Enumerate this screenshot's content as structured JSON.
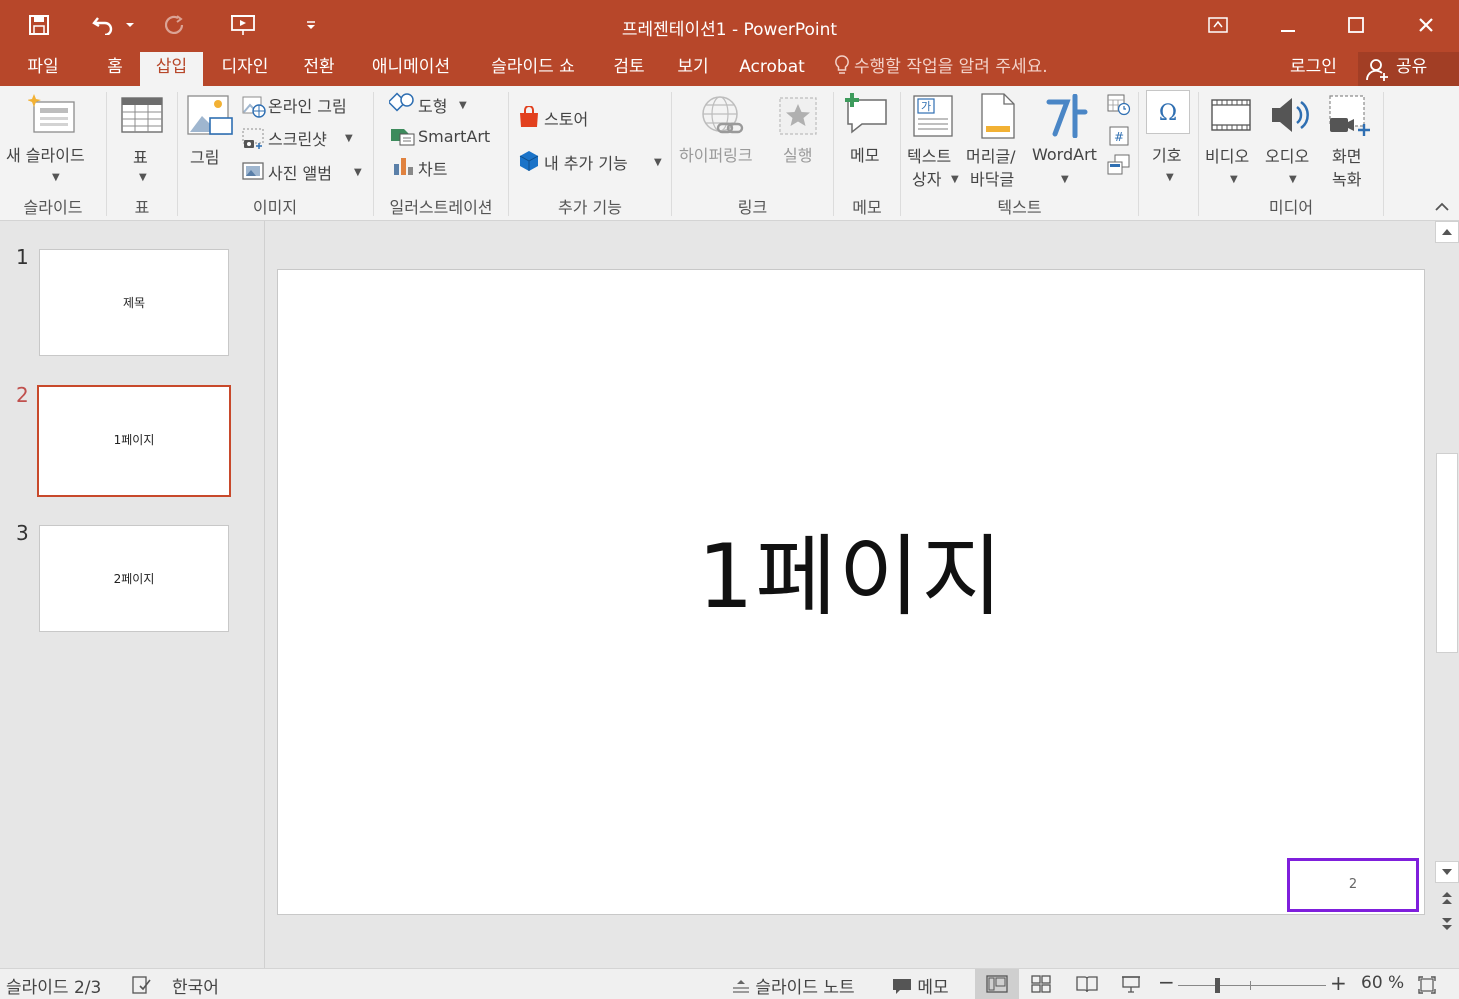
{
  "window": {
    "title": "프레젠테이션1 - PowerPoint"
  },
  "menu_tabs": [
    {
      "label": "파일"
    },
    {
      "label": "홈"
    },
    {
      "label": "삽입",
      "active": true
    },
    {
      "label": "디자인"
    },
    {
      "label": "전환"
    },
    {
      "label": "애니메이션"
    },
    {
      "label": "슬라이드 쇼"
    },
    {
      "label": "검토"
    },
    {
      "label": "보기"
    },
    {
      "label": "Acrobat"
    }
  ],
  "tell_me": "수행할 작업을 알려 주세요.",
  "login": "로그인",
  "share": "공유",
  "ribbon": {
    "new_slide": "새 슬라이드",
    "table": "표",
    "picture": "그림",
    "online_picture": "온라인 그림",
    "screenshot": "스크린샷",
    "photo_album": "사진 앨범",
    "shapes": "도형",
    "smartart": "SmartArt",
    "chart": "차트",
    "store": "스토어",
    "my_addins": "내 추가 기능",
    "hyperlink": "하이퍼링크",
    "action": "실행",
    "comment": "메모",
    "textbox_1": "텍스트",
    "textbox_2": "상자",
    "header_1": "머리글/",
    "header_2": "바닥글",
    "wordart": "WordArt",
    "symbol": "기호",
    "video": "비디오",
    "audio": "오디오",
    "screen_rec_1": "화면",
    "screen_rec_2": "녹화",
    "groups": {
      "slides": "슬라이드",
      "tables": "표",
      "images": "이미지",
      "illustrations": "일러스트레이션",
      "addins": "추가 기능",
      "links": "링크",
      "comments": "메모",
      "text": "텍스트",
      "media": "미디어"
    }
  },
  "thumbnails": [
    {
      "num": "1",
      "title": "제목"
    },
    {
      "num": "2",
      "title": "1페이지",
      "active": true
    },
    {
      "num": "3",
      "title": "2페이지"
    }
  ],
  "slide": {
    "title": "1페이지",
    "page_number": "2"
  },
  "status": {
    "slide_info": "슬라이드 2/3",
    "language": "한국어",
    "notes": "슬라이드 노트",
    "comments": "메모",
    "zoom": "60 %",
    "zoom_level": 0.6
  },
  "colors": {
    "accent": "#b7472a",
    "selection": "#7f1fdc"
  }
}
